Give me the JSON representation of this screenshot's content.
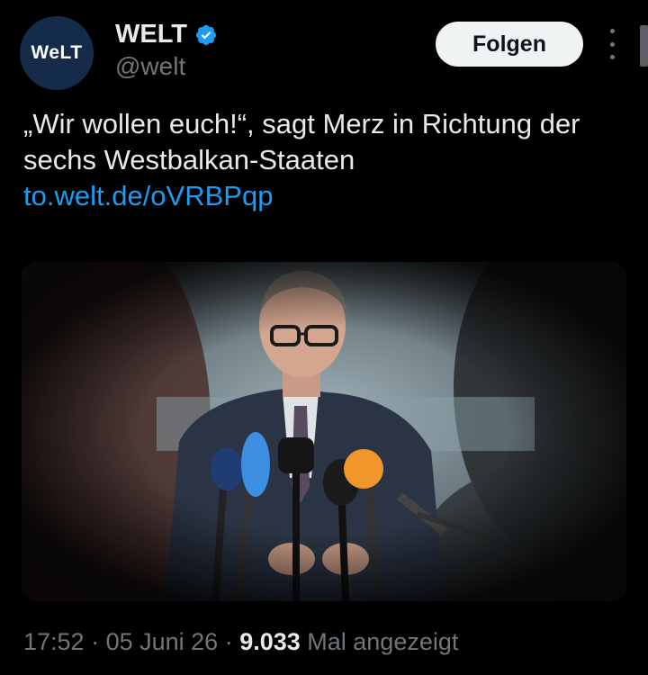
{
  "author": {
    "avatar_text": "WeLT",
    "display_name": "WELT",
    "handle": "@welt",
    "verified": true
  },
  "actions": {
    "follow_label": "Folgen"
  },
  "tweet": {
    "text": "„Wir wollen euch!“, sagt Merz in Richtung der sechs Westbalkan-Staaten",
    "link": "to.welt.de/oVRBPqp"
  },
  "meta": {
    "time": "17:52",
    "sep1": " · ",
    "date": "05 Juni 26",
    "sep2": " · ",
    "views_count": "9.033",
    "views_label": " Mal angezeigt"
  },
  "colors": {
    "background": "#000000",
    "link": "#1d9bf0",
    "verified_badge": "#1d9bf0",
    "muted": "#71767b"
  },
  "icons": [
    "verified-badge-icon",
    "more-options-icon"
  ]
}
